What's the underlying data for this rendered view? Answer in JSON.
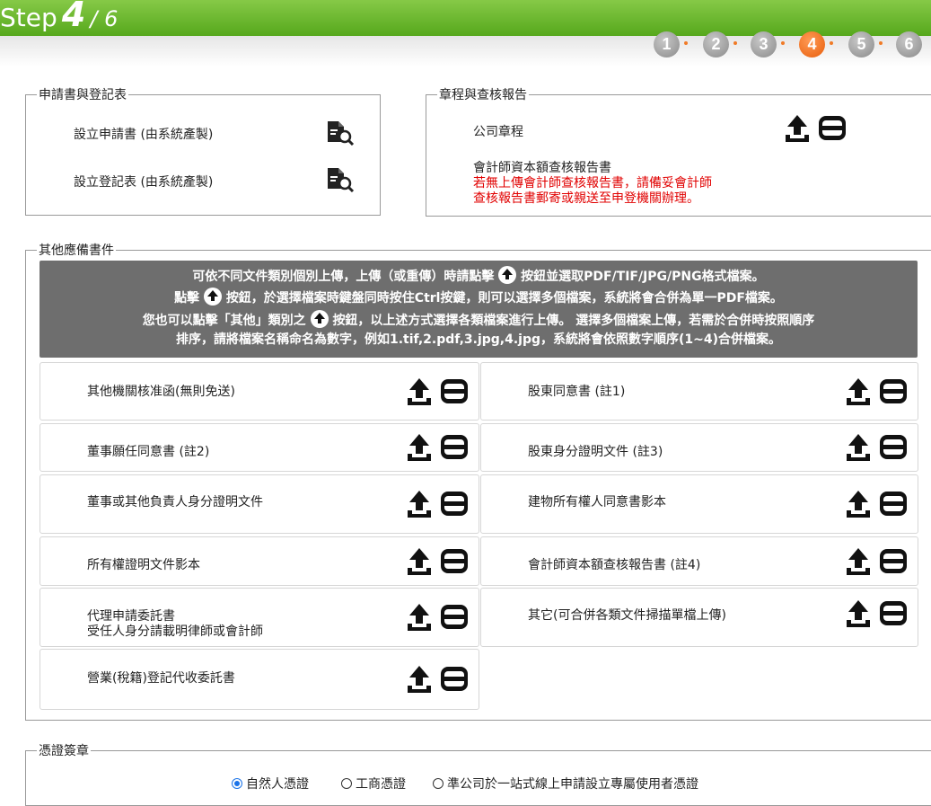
{
  "header": {
    "step_word": "Step",
    "step_current": "4",
    "step_total": "/ 6",
    "steps": [
      "1",
      "2",
      "3",
      "4",
      "5",
      "6"
    ],
    "active_step": "4"
  },
  "section_apply": {
    "legend": "申請書與登記表",
    "items": [
      "設立申請書 (由系統產製)",
      "設立登記表 (由系統產製)"
    ]
  },
  "section_charter": {
    "legend": "章程與查核報告",
    "item1": "公司章程",
    "item2": "會計師資本額查核報告書",
    "note1": "若無上傳會計師查核報告書，請備妥會計師",
    "note2": "查核報告書郵寄或親送至申登機關辦理。"
  },
  "section_other": {
    "legend": "其他應備書件",
    "banner": {
      "l1a": "可依不同文件類別個別上傳，上傳（或重傳）時請點擊",
      "l1b": "按鈕並選取PDF/TIF/JPG/PNG格式檔案。",
      "l2a": "點擊",
      "l2b": "按鈕，於選擇檔案時鍵盤同時按住Ctrl按鍵，則可以選擇多個檔案，系統將會合併為單一PDF檔案。",
      "l3a": "您也可以點擊「其他」類別之",
      "l3b": "按鈕，以上述方式選擇各類檔案進行上傳。 選擇多個檔案上傳，若需於合併時按照順序",
      "l4": "排序，請將檔案名稱命名為數字，例如1.tif,2.pdf,3.jpg,4.jpg，系統將會依照數字順序(1~4)合併檔案。"
    },
    "docs": [
      {
        "label": "其他機關核准函(無則免送)"
      },
      {
        "label": "股東同意書 (註1)"
      },
      {
        "label": "董事願任同意書 (註2)"
      },
      {
        "label": "股東身分證明文件 (註3)"
      },
      {
        "label": "董事或其他負責人身分證明文件"
      },
      {
        "label": "建物所有權人同意書影本"
      },
      {
        "label": "所有權證明文件影本"
      },
      {
        "label": "會計師資本額查核報告書 (註4)"
      },
      {
        "label": "代理申請委託書",
        "note": "受任人身分請載明律師或會計師"
      },
      {
        "label": "其它(可合併各類文件掃描單檔上傳)"
      },
      {
        "label": "營業(稅籍)登記代收委託書"
      }
    ]
  },
  "section_cert": {
    "legend": "憑證簽章",
    "options": [
      "自然人憑證",
      "工商憑證",
      "準公司於一站式線上申請設立專屬使用者憑證"
    ],
    "selected": "自然人憑證"
  },
  "colors": {
    "header_green": "#5aab1f",
    "active_step": "#f07a26",
    "note_red": "#e10000",
    "banner_bg": "#6e6e6e"
  }
}
